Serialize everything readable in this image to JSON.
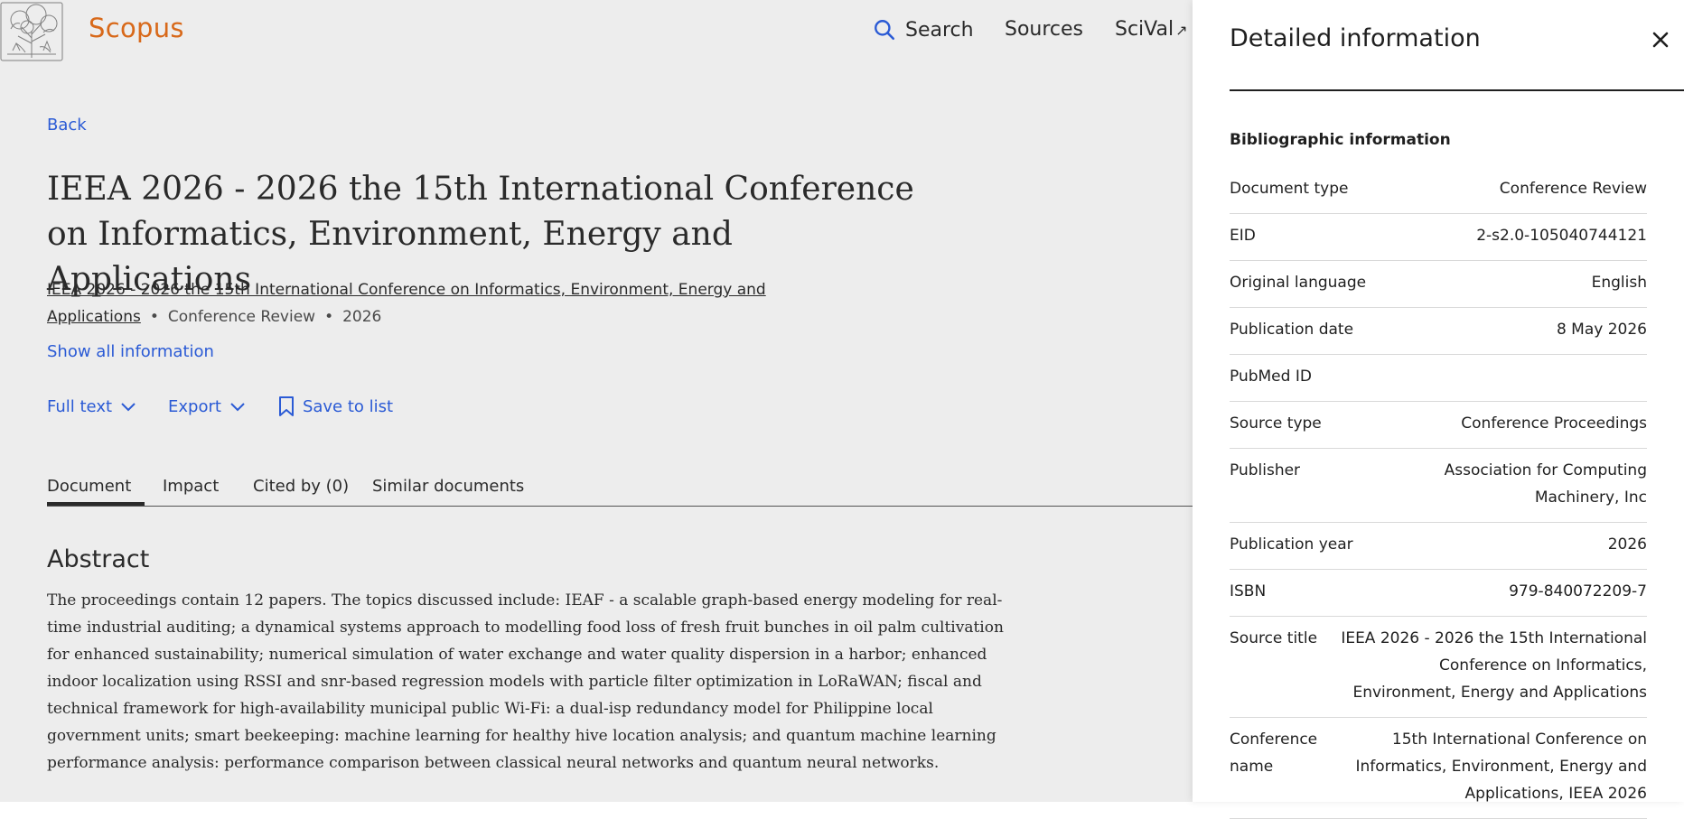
{
  "header": {
    "brand": "Scopus",
    "nav": {
      "search": "Search",
      "sources": "Sources",
      "scival": "SciVal",
      "scival_ext": "↗"
    }
  },
  "main": {
    "back": "Back",
    "title": "IEEA 2026 - 2026 the 15th International Conference on Informatics, Environment, Energy and Applications",
    "meta": {
      "source_link": "IEEA 2026 - 2026 the 15th International Conference on Informatics, Environment, Energy and Applications",
      "separator": "•",
      "doc_type": "Conference Review",
      "year": "2026"
    },
    "show_all": "Show all information",
    "actions": {
      "full_text": "Full text",
      "export": "Export",
      "save": "Save to list"
    },
    "tabs": [
      {
        "label": "Document",
        "active": true
      },
      {
        "label": "Impact"
      },
      {
        "label": "Cited by (0)"
      },
      {
        "label": "Similar documents"
      }
    ],
    "abstract_heading": "Abstract",
    "abstract": "The proceedings contain 12 papers. The topics discussed include: IEAF - a scalable graph-based energy modeling for real-time industrial auditing; a dynamical systems approach to modelling food loss of fresh fruit bunches in oil palm cultivation for enhanced sustainability; numerical simulation of water exchange and water quality dispersion in a harbor; enhanced indoor localization using RSSI and snr-based regression models with particle filter optimization in LoRaWAN; fiscal and technical framework for high-availability municipal public Wi-Fi: a dual-isp redundancy model for Philippine local government units; smart beekeeping: machine learning for healthy hive location analysis; and quantum machine learning performance analysis: performance comparison between classical neural networks and quantum neural networks."
  },
  "panel": {
    "title": "Detailed information",
    "section": "Bibliographic information",
    "rows": [
      {
        "label": "Document type",
        "value": "Conference Review"
      },
      {
        "label": "EID",
        "value": "2-s2.0-105040744121"
      },
      {
        "label": "Original language",
        "value": "English"
      },
      {
        "label": "Publication date",
        "value": "8 May 2026"
      },
      {
        "label": "PubMed ID",
        "value": ""
      },
      {
        "label": "Source type",
        "value": "Conference Proceedings"
      },
      {
        "label": "Publisher",
        "value": "Association for Computing Machinery, Inc"
      },
      {
        "label": "Publication year",
        "value": "2026"
      },
      {
        "label": "ISBN",
        "value": "979-840072209-7"
      },
      {
        "label": "Source title",
        "value": "IEEA 2026 - 2026 the 15th International Conference on Informatics, Environment, Energy and Applications"
      },
      {
        "label": "Conference name",
        "value": "15th International Conference on Informatics, Environment, Energy and Applications, IEEA 2026"
      }
    ]
  },
  "colors": {
    "brand": "#e9711c",
    "link": "#2f62e6",
    "text": "#2e2e2e"
  },
  "icons": [
    "elsevier-tree-logo",
    "search-icon",
    "chevron-down-icon",
    "bookmark-icon",
    "close-icon",
    "external-link-icon"
  ]
}
